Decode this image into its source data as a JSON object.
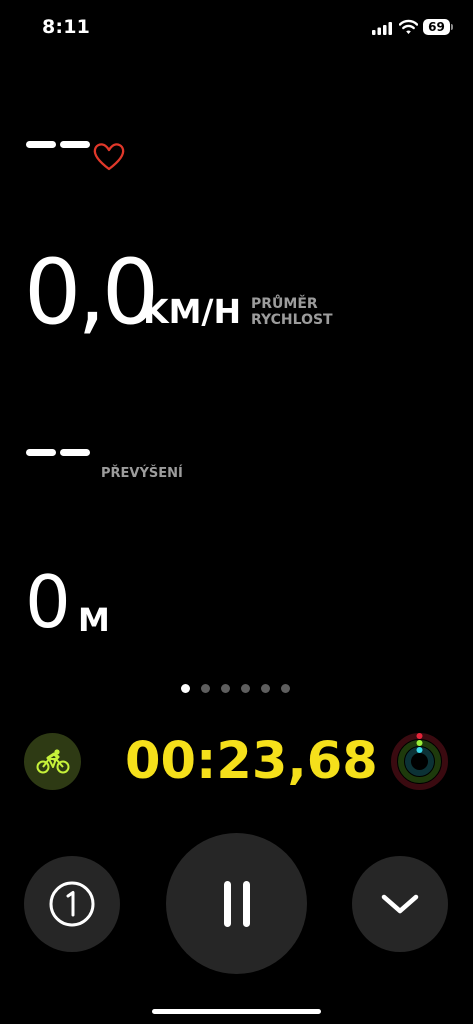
{
  "status_bar": {
    "time": "8:11",
    "battery": "69",
    "icons": [
      "cellular-signal-icon",
      "wifi-icon",
      "battery-icon"
    ]
  },
  "metrics": {
    "heart_rate": {
      "value": "——",
      "icon": "heart-icon",
      "icon_color": "#e0382a"
    },
    "avg_speed": {
      "value": "0,0",
      "unit": "KM/H",
      "caption_line1": "PRŮMĚR",
      "caption_line2": "RYCHLOST"
    },
    "elevation": {
      "value": "——",
      "caption": "PŘEVÝŠENÍ"
    },
    "distance": {
      "value": "0",
      "unit": "M"
    }
  },
  "pager": {
    "pages": 6,
    "current": 1
  },
  "workout": {
    "type_icon": "cycling-icon",
    "accent": "#c6f23a",
    "elapsed": "00:23,68",
    "timer_color": "#f5e01b"
  },
  "controls": {
    "segment_icon": "segment-one-icon",
    "pause_icon": "pause-icon",
    "collapse_icon": "chevron-down-icon"
  },
  "colors": {
    "background": "#000000",
    "button": "#262626",
    "ring_move": "#e5253a",
    "ring_exercise": "#9cf03a",
    "ring_stand": "#3bd6e6"
  }
}
